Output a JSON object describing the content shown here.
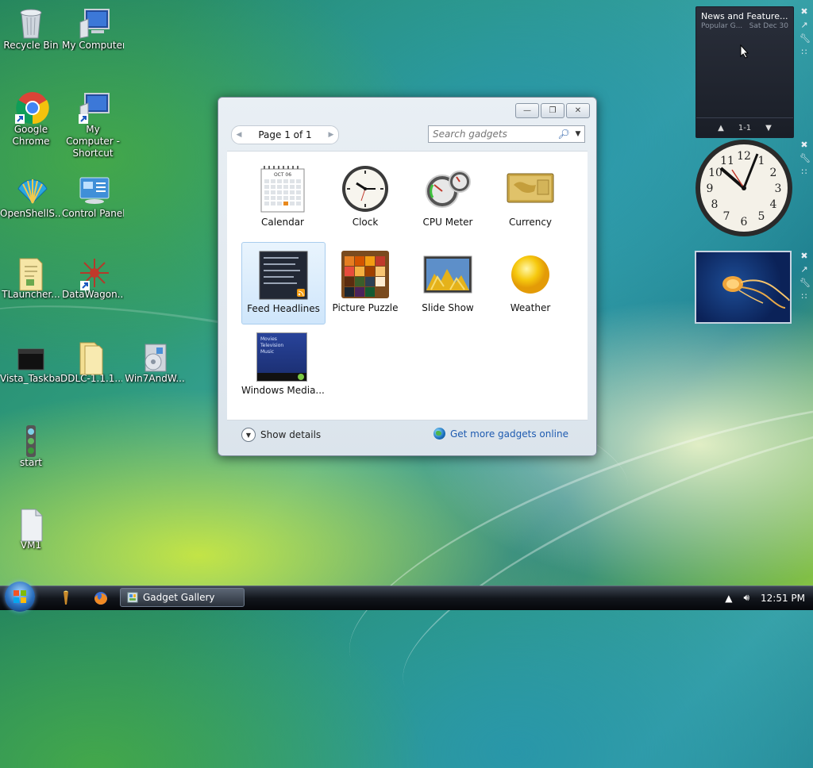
{
  "desktop": {
    "icons": [
      {
        "label": "Recycle Bin",
        "icon": "recycle-bin-icon"
      },
      {
        "label": "My Computer",
        "icon": "computer-icon"
      },
      {
        "label": "Google Chrome",
        "icon": "chrome-icon"
      },
      {
        "label": "My Computer - Shortcut",
        "icon": "computer-shortcut-icon"
      },
      {
        "label": "OpenShellS...",
        "icon": "shell-icon"
      },
      {
        "label": "Control Panel",
        "icon": "control-panel-icon"
      },
      {
        "label": "TLauncher...",
        "icon": "folder-icon"
      },
      {
        "label": "DataWagon...",
        "icon": "datawagon-icon"
      },
      {
        "label": "Vista_Taskbar",
        "icon": "black-window-icon"
      },
      {
        "label": "DDLC-1.1.1...",
        "icon": "folder-icon"
      },
      {
        "label": "Win7AndW...",
        "icon": "installer-icon"
      },
      {
        "label": "start",
        "icon": "traffic-light-icon"
      },
      {
        "label": "VM1",
        "icon": "file-icon"
      }
    ]
  },
  "gallery": {
    "window_title": "Gadget Gallery",
    "pager_text": "Page 1 of 1",
    "search_placeholder": "Search gadgets",
    "gadgets": [
      {
        "name": "Calendar",
        "icon": "calendar-icon"
      },
      {
        "name": "Clock",
        "icon": "clock-icon"
      },
      {
        "name": "CPU Meter",
        "icon": "cpu-meter-icon"
      },
      {
        "name": "Currency",
        "icon": "currency-icon"
      },
      {
        "name": "Feed Headlines",
        "icon": "feed-headlines-icon",
        "selected": true
      },
      {
        "name": "Picture Puzzle",
        "icon": "picture-puzzle-icon"
      },
      {
        "name": "Slide Show",
        "icon": "slide-show-icon"
      },
      {
        "name": "Weather",
        "icon": "weather-icon"
      },
      {
        "name": "Windows Media...",
        "icon": "windows-media-icon"
      }
    ],
    "calendar_month": "OCT 06",
    "media_lines": [
      "Movies",
      "Television",
      "Music"
    ],
    "show_details": "Show details",
    "get_more": "Get more gadgets online"
  },
  "sidebar": {
    "feed_title": "News and Feature...",
    "feed_source": "Popular G...",
    "feed_date": "Sat Dec 30",
    "feed_page": "1-1"
  },
  "taskbar": {
    "active_window": "Gadget Gallery",
    "clock": "12:51 PM"
  }
}
